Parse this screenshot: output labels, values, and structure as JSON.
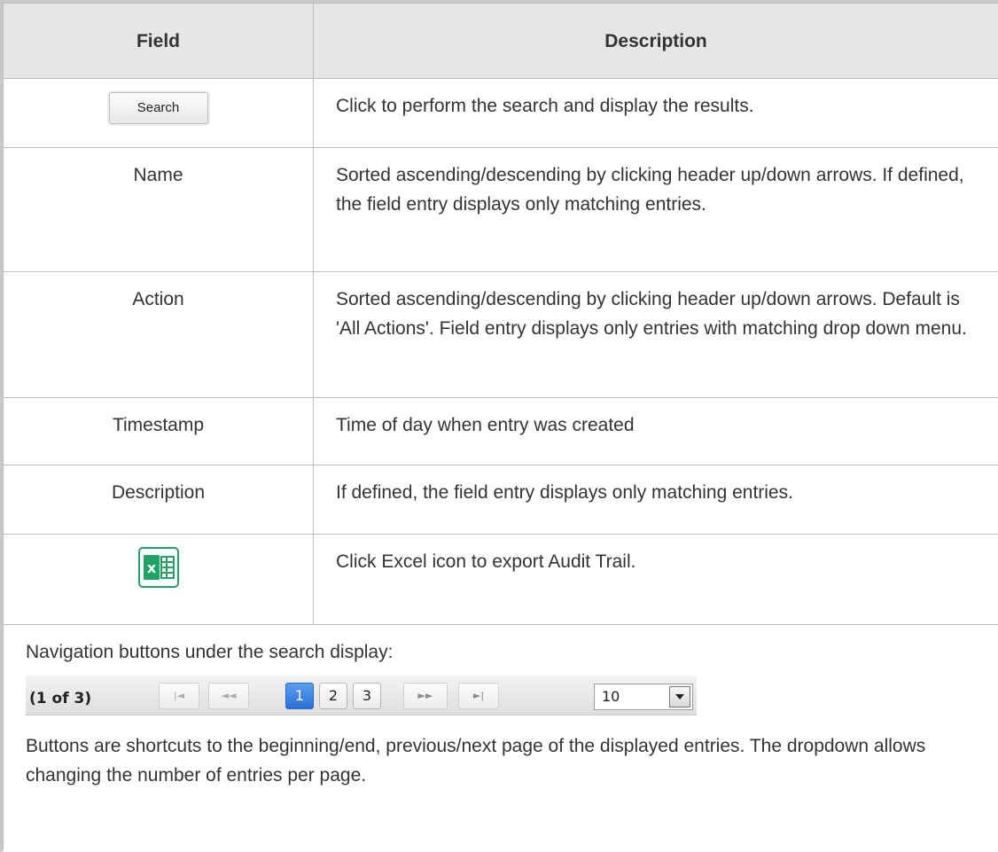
{
  "header": {
    "field": "Field",
    "description": "Description"
  },
  "rows": [
    {
      "field": "",
      "button_label": "Search",
      "description": "Click to perform the search and display the results."
    },
    {
      "field": "Name",
      "description": "Sorted ascending/descending by clicking header up/down arrows. If defined, the field entry displays only matching entries."
    },
    {
      "field": "Action",
      "description": "Sorted ascending/descending by clicking header up/down arrows. Default is 'All Actions'. Field entry displays only entries with matching drop down menu."
    },
    {
      "field": "Timestamp",
      "description": "Time of day when entry was created"
    },
    {
      "field": "Description",
      "description": "If defined, the field entry displays only matching entries."
    },
    {
      "field": "",
      "icon": "excel-icon",
      "description": "Click Excel icon to export Audit Trail."
    }
  ],
  "navigation": {
    "intro": "Navigation buttons under the search display:",
    "page_count": "(1 of 3)",
    "first_glyph": "|◄",
    "prev_glyph": "◄◄",
    "pages": [
      "1",
      "2",
      "3"
    ],
    "active_page": "1",
    "next_glyph": "►►",
    "last_glyph": "►|",
    "per_page": "10",
    "explanation": "Buttons are shortcuts to the beginning/end, previous/next page of the displayed entries. The dropdown allows changing the number of entries per page."
  },
  "colors": {
    "header_bg": "#e6e6e6",
    "border": "#bdbdbd",
    "excel_green": "#21a366",
    "active_page": "#2a6fd6"
  }
}
